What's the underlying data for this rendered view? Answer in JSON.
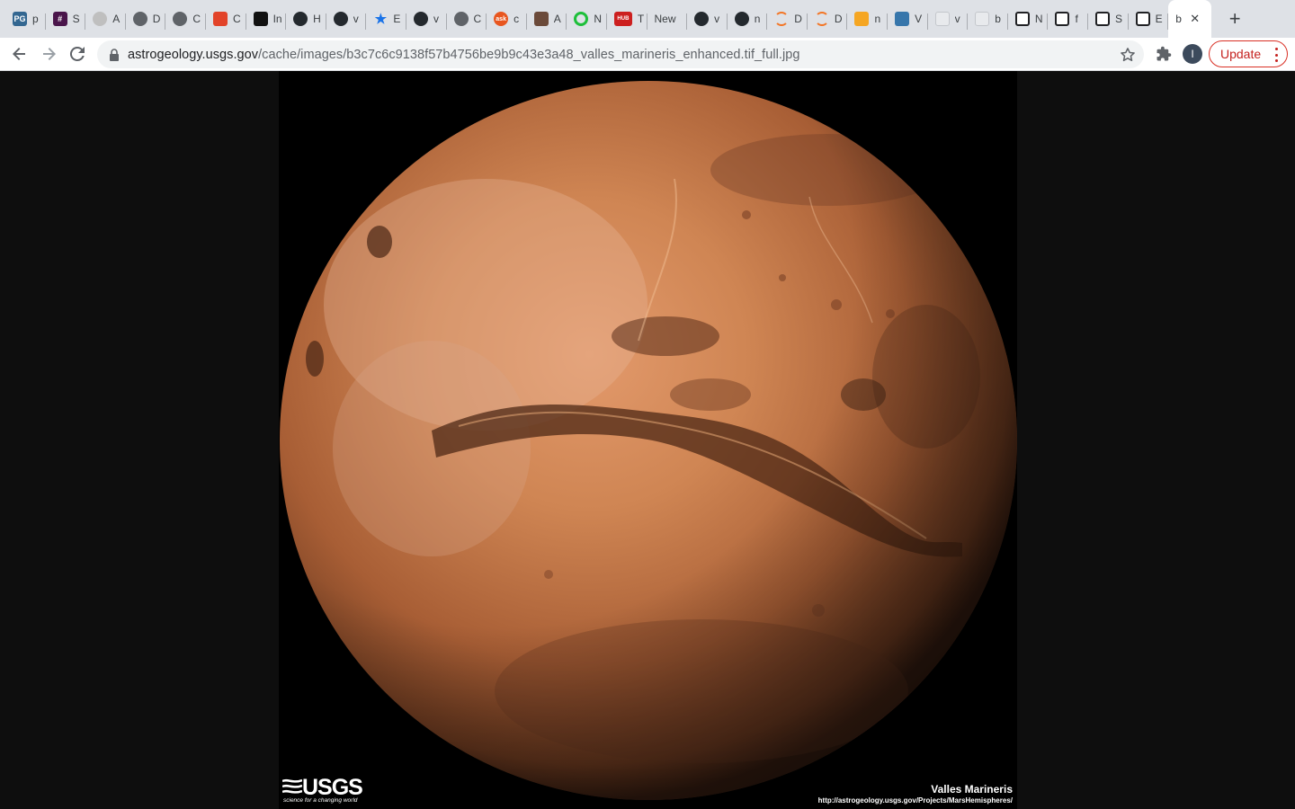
{
  "browser": {
    "tabs": [
      {
        "label": "p",
        "favicon": "pg-icon",
        "color": "#336791",
        "glyph": "PG"
      },
      {
        "label": "S",
        "favicon": "slack-icon",
        "color": "#4a154b",
        "glyph": "#"
      },
      {
        "label": "A",
        "favicon": "clock-icon",
        "color": "#bfbfbf",
        "glyph": ""
      },
      {
        "label": "D",
        "favicon": "globe-icon",
        "color": "#5f6368",
        "glyph": ""
      },
      {
        "label": "C",
        "favicon": "globe-icon",
        "color": "#5f6368",
        "glyph": ""
      },
      {
        "label": "C",
        "favicon": "gitlab-icon",
        "color": "#e24329",
        "glyph": ""
      },
      {
        "label": "In",
        "favicon": "bookmark-icon",
        "color": "#111111",
        "glyph": ""
      },
      {
        "label": "H",
        "favicon": "github-icon",
        "color": "#24292e",
        "glyph": ""
      },
      {
        "label": "v",
        "favicon": "github-icon",
        "color": "#24292e",
        "glyph": ""
      },
      {
        "label": "E",
        "favicon": "star-icon",
        "color": "#1a73e8",
        "glyph": "★"
      },
      {
        "label": "v",
        "favicon": "github-icon",
        "color": "#24292e",
        "glyph": ""
      },
      {
        "label": "C",
        "favicon": "globe-icon",
        "color": "#5f6368",
        "glyph": ""
      },
      {
        "label": "c",
        "favicon": "ask-icon",
        "color": "#e8561f",
        "glyph": "ask"
      },
      {
        "label": "A",
        "favicon": "avatar-icon",
        "color": "#6b4a3a",
        "glyph": ""
      },
      {
        "label": "N",
        "favicon": "ring-icon",
        "color": "#1dbf3a",
        "glyph": ""
      },
      {
        "label": "T",
        "favicon": "hub-icon",
        "color": "#cc1f1f",
        "glyph": "HUB"
      },
      {
        "label": "New",
        "favicon": "none",
        "color": "",
        "glyph": ""
      },
      {
        "label": "v",
        "favicon": "github-icon",
        "color": "#24292e",
        "glyph": ""
      },
      {
        "label": "n",
        "favicon": "github-icon",
        "color": "#24292e",
        "glyph": ""
      },
      {
        "label": "D",
        "favicon": "jupyter-icon",
        "color": "#f37626",
        "glyph": ""
      },
      {
        "label": "D",
        "favicon": "jupyter-icon",
        "color": "#f37626",
        "glyph": ""
      },
      {
        "label": "n",
        "favicon": "notebook-icon",
        "color": "#f5a623",
        "glyph": ""
      },
      {
        "label": "V",
        "favicon": "python-icon",
        "color": "#3776ab",
        "glyph": ""
      },
      {
        "label": "v",
        "favicon": "cube-icon",
        "color": "#e8eaed",
        "glyph": ""
      },
      {
        "label": "b",
        "favicon": "cube-icon",
        "color": "#e8eaed",
        "glyph": ""
      },
      {
        "label": "N",
        "favicon": "wave-icon",
        "color": "#202124",
        "glyph": ""
      },
      {
        "label": "f",
        "favicon": "wave-icon",
        "color": "#202124",
        "glyph": ""
      },
      {
        "label": "S",
        "favicon": "wave-icon",
        "color": "#202124",
        "glyph": ""
      },
      {
        "label": "E",
        "favicon": "wave-icon",
        "color": "#202124",
        "glyph": ""
      }
    ],
    "active_tab": {
      "label": "b",
      "close": "✕"
    },
    "new_tab": "+",
    "url_host": "astrogeology.usgs.gov",
    "url_path": "/cache/images/b3c7c6c9138f57b4756be9b9c43e3a48_valles_marineris_enhanced.tif_full.jpg",
    "profile_initial": "I",
    "update_label": "Update"
  },
  "image": {
    "logo_text": "USGS",
    "logo_tagline": "science for a changing world",
    "caption_title": "Valles Marineris",
    "caption_url": "http://astrogeology.usgs.gov/Projects/MarsHemispheres/"
  }
}
